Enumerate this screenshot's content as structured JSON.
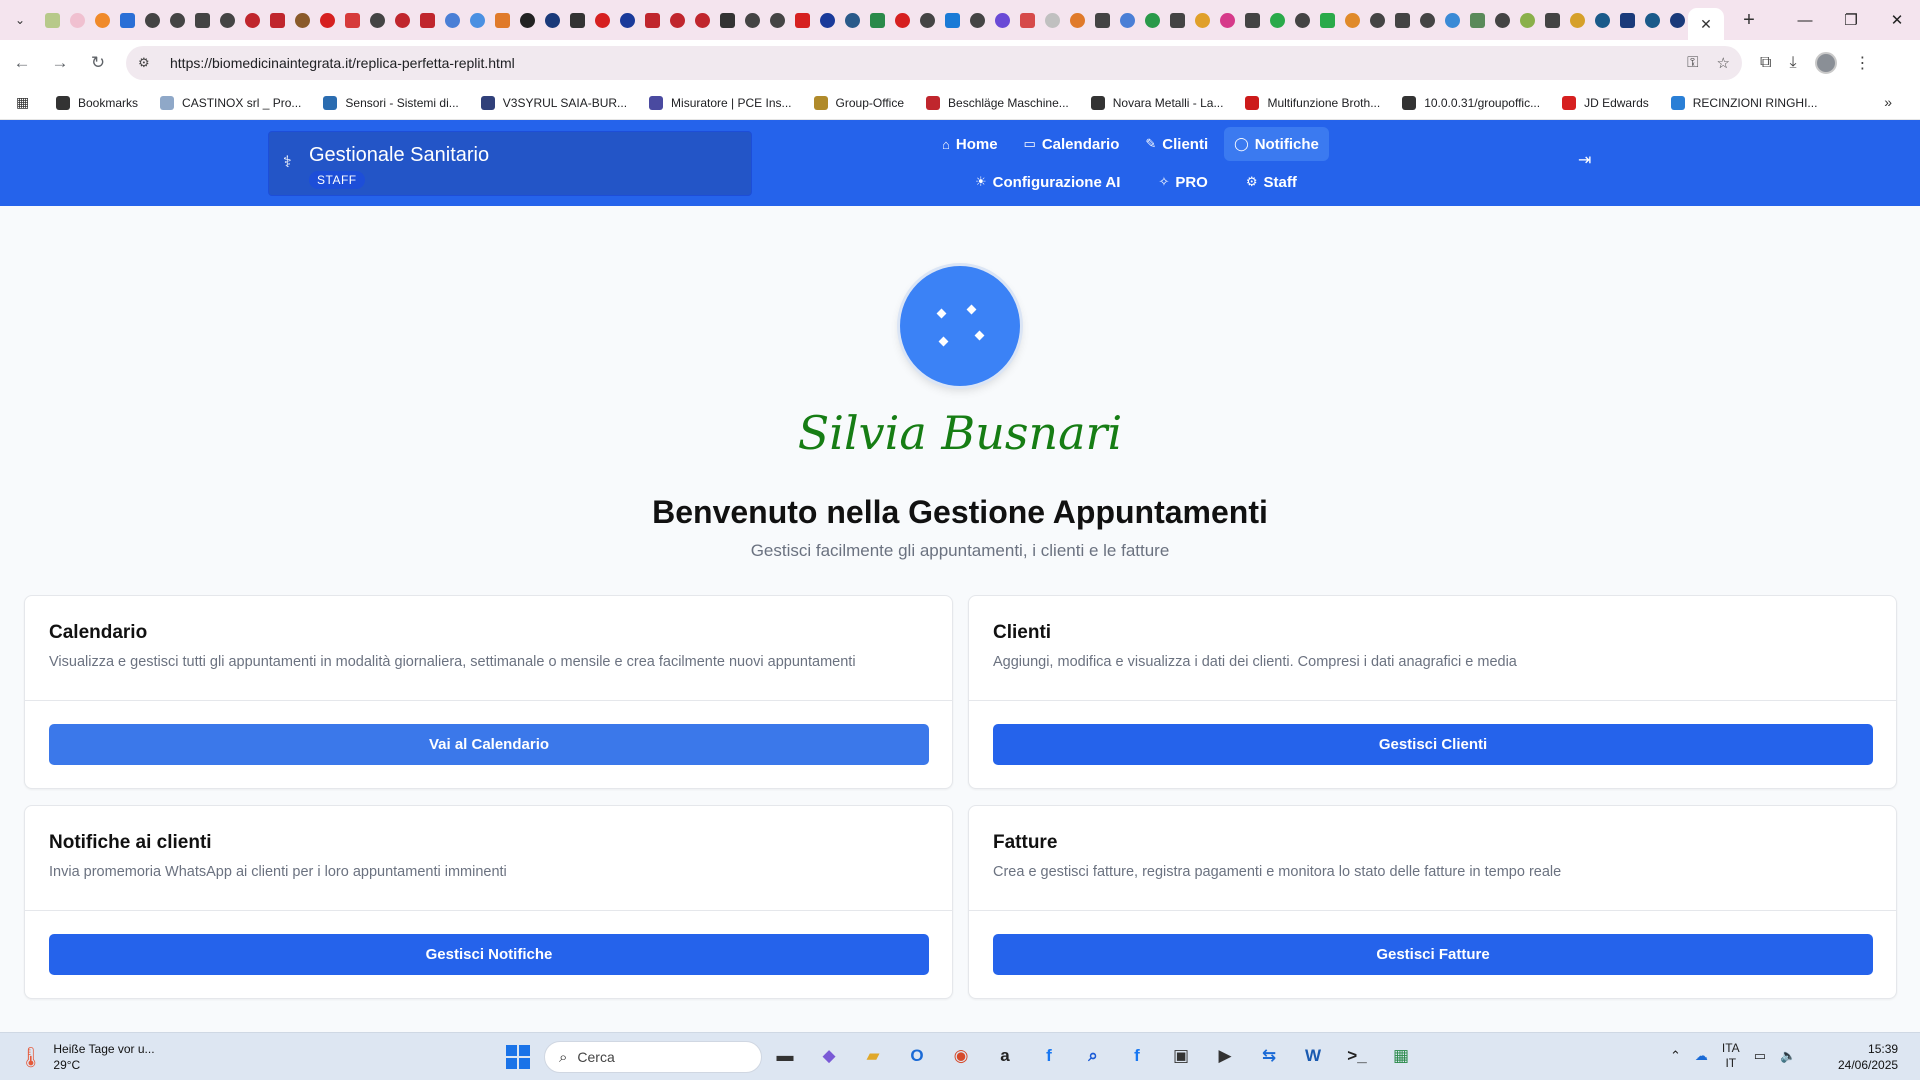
{
  "browser": {
    "tab_close": "✕",
    "new_tab": "+",
    "url": "https://biomedicinaintegrata.it/replica-perfetta-replit.html",
    "bookmarks": [
      {
        "label": "Bookmarks",
        "color": "#333333"
      },
      {
        "label": "CASTINOX srl _ Pro...",
        "color": "#8fa8c8"
      },
      {
        "label": "Sensori - Sistemi di...",
        "color": "#2b6cb0"
      },
      {
        "label": "V3SYRUL SAIA-BUR...",
        "color": "#30407a"
      },
      {
        "label": "Misuratore | PCE Ins...",
        "color": "#4a4aa0"
      },
      {
        "label": "Group-Office",
        "color": "#b08a2a"
      },
      {
        "label": "Beschläge Maschine...",
        "color": "#c0262d"
      },
      {
        "label": "Novara Metalli - La...",
        "color": "#333333"
      },
      {
        "label": "Multifunzione Broth...",
        "color": "#cc1a1a"
      },
      {
        "label": "10.0.0.31/groupoffic...",
        "color": "#333333"
      },
      {
        "label": "JD Edwards",
        "color": "#d62020"
      },
      {
        "label": "RECINZIONI RINGHI...",
        "color": "#2a7fd6"
      }
    ],
    "favicon_colors": [
      "#b7c98a",
      "#f0c0d0",
      "#f08a2a",
      "#2a6fd6",
      "#444444",
      "#444444",
      "#444444",
      "#444444",
      "#c0262d",
      "#c0262d",
      "#8a5a2a",
      "#d62020",
      "#d63a3a",
      "#444444",
      "#c0262d",
      "#c0262d",
      "#4a7fd6",
      "#4a90e2",
      "#e07a2a",
      "#222222",
      "#1a3a7a",
      "#333333",
      "#d62020",
      "#1a3a9a",
      "#c0262d",
      "#c0262d",
      "#c0262d",
      "#333333",
      "#444444",
      "#444444",
      "#d62020",
      "#1a3a9a",
      "#2a5a8a",
      "#2a8a4a",
      "#d62020",
      "#444444",
      "#1a7ad6",
      "#444444",
      "#6a4ad6",
      "#d64a4a",
      "#c0c0c0",
      "#e07a2a",
      "#444444",
      "#4a7fd6",
      "#2a9a4a",
      "#444444",
      "#e0a02a",
      "#d63a8a",
      "#444444",
      "#2aaa4a",
      "#444444",
      "#2aaa4a",
      "#e08a2a",
      "#444444",
      "#444444",
      "#444444",
      "#3a8ad6",
      "#5a8a5a",
      "#444444",
      "#8ab04a",
      "#444444",
      "#d6a02a",
      "#1a5a8a",
      "#1a3a7a",
      "#1a5a8a",
      "#1a3a7a"
    ]
  },
  "app": {
    "brand_title": "Gestionale Sanitario",
    "brand_badge": "STAFF",
    "nav_row1": [
      {
        "label": "Home",
        "icon": "⌂"
      },
      {
        "label": "Calendario",
        "icon": "▭"
      },
      {
        "label": "Clienti",
        "icon": "✎"
      },
      {
        "label": "Notifiche",
        "icon": "◯",
        "active": true
      }
    ],
    "nav_row2": [
      {
        "label": "Configurazione AI",
        "icon": "☀"
      },
      {
        "label": "PRO",
        "icon": "✧"
      },
      {
        "label": "Staff",
        "icon": "⚙"
      }
    ]
  },
  "main": {
    "signature": "Silvia Busnari",
    "title": "Benvenuto nella Gestione Appuntamenti",
    "subtitle": "Gestisci facilmente gli appuntamenti, i clienti e le fatture",
    "cards": [
      {
        "title": "Calendario",
        "desc": "Visualizza e gestisci tutti gli appuntamenti in modalità giornaliera, settimanale o mensile e crea facilmente nuovi appuntamenti",
        "button": "Vai al Calendario"
      },
      {
        "title": "Clienti",
        "desc": "Aggiungi, modifica e visualizza i dati dei clienti. Compresi i dati anagrafici e media",
        "button": "Gestisci Clienti"
      },
      {
        "title": "Notifiche ai clienti",
        "desc": "Invia promemoria WhatsApp ai clienti per i loro appuntamenti imminenti",
        "button": "Gestisci Notifiche"
      },
      {
        "title": "Fatture",
        "desc": "Crea e gestisci fatture, registra pagamenti e monitora lo stato delle fatture in tempo reale",
        "button": "Gestisci Fatture"
      }
    ]
  },
  "taskbar": {
    "weather_title": "Heiße Tage vor u...",
    "weather_temp": "29°C",
    "search_placeholder": "Cerca",
    "lang_top": "ITA",
    "lang_bottom": "IT",
    "time": "15:39",
    "date": "24/06/2025",
    "apps": [
      {
        "name": "task-view",
        "glyph": "▬",
        "color": "#333333"
      },
      {
        "name": "app-m365",
        "glyph": "◆",
        "color": "#7a5ad6"
      },
      {
        "name": "file-explorer",
        "glyph": "▰",
        "color": "#e0a82a"
      },
      {
        "name": "outlook",
        "glyph": "O",
        "color": "#1a6ad6"
      },
      {
        "name": "chrome",
        "glyph": "◉",
        "color": "#d64a2a"
      },
      {
        "name": "amazon",
        "glyph": "a",
        "color": "#222222"
      },
      {
        "name": "facebook",
        "glyph": "f",
        "color": "#1877f2"
      },
      {
        "name": "search-app",
        "glyph": "⌕",
        "color": "#1a5ad6"
      },
      {
        "name": "facebook-2",
        "glyph": "f",
        "color": "#1877f2"
      },
      {
        "name": "store",
        "glyph": "▣",
        "color": "#333333"
      },
      {
        "name": "media",
        "glyph": "▶",
        "color": "#333333"
      },
      {
        "name": "teamviewer",
        "glyph": "⇆",
        "color": "#1a6ad6"
      },
      {
        "name": "word",
        "glyph": "W",
        "color": "#1a5ab0"
      },
      {
        "name": "terminal",
        "glyph": ">_",
        "color": "#222222"
      },
      {
        "name": "excel-remote",
        "glyph": "▦",
        "color": "#2a8a4a"
      }
    ]
  }
}
